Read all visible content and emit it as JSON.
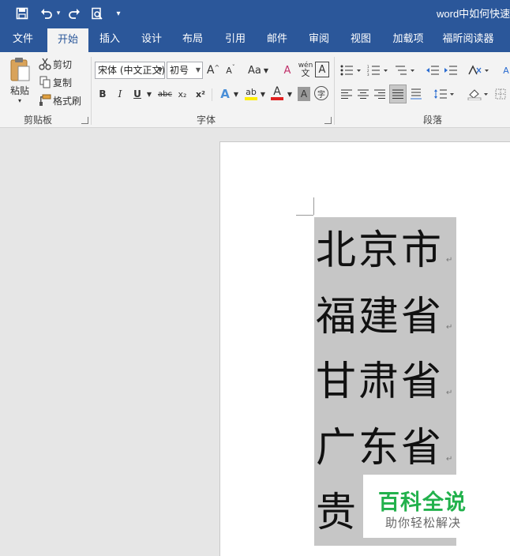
{
  "window": {
    "title": "word中如何快速分"
  },
  "quick_access": {
    "save": "💾",
    "undo": "↶",
    "undo_more": "▾",
    "redo": "↷",
    "print_preview": "🔍",
    "customize": "▾"
  },
  "tabs": [
    "文件",
    "开始",
    "插入",
    "设计",
    "布局",
    "引用",
    "邮件",
    "审阅",
    "视图",
    "加载项",
    "福昕阅读器"
  ],
  "active_tab": "开始",
  "clipboard": {
    "label": "剪贴板",
    "paste": "粘贴",
    "paste_arrow": "▾",
    "cut": "剪切",
    "copy": "复制",
    "format_painter": "格式刷"
  },
  "font": {
    "label": "字体",
    "font_name": "宋体 (中文正文)",
    "font_size": "初号",
    "grow": "A",
    "shrink": "A",
    "change_case": "Aa",
    "clear_format": "A",
    "phonetic": "wén",
    "char_border": "A",
    "bold": "B",
    "italic": "I",
    "underline": "U",
    "strikethrough": "abc",
    "subscript": "x₂",
    "superscript": "x²",
    "text_effects": "A",
    "highlight": "ab",
    "font_color": "A",
    "char_shading": "A",
    "enclose": "字"
  },
  "paragraph": {
    "label": "段落"
  },
  "document": {
    "lines": [
      "北京市",
      "福建省",
      "甘肃省",
      "广东省",
      "贵"
    ],
    "paragraph_mark": "↵"
  },
  "watermark": {
    "title": "百科全说",
    "subtitle": "助你轻松解决"
  },
  "colors": {
    "ribbon_blue": "#2b579a",
    "selection": "#c6c6c6",
    "watermark_green": "#22b14c",
    "font_color_red": "#e02020",
    "highlight_yellow": "#ffee00"
  }
}
